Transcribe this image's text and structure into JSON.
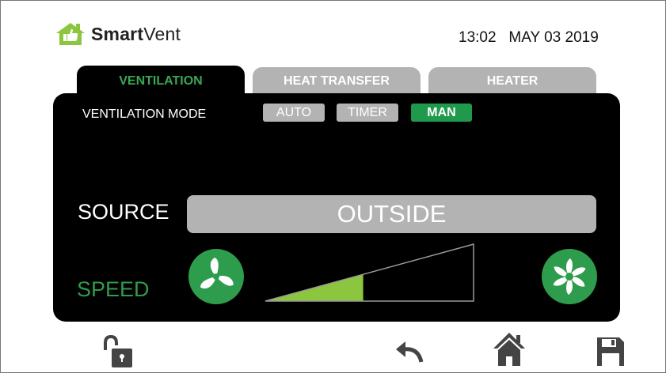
{
  "brand": {
    "name_bold": "Smart",
    "name_light": "Vent"
  },
  "datetime": {
    "time": "13:02",
    "date": "MAY 03 2019"
  },
  "tabs": [
    {
      "label": "VENTILATION",
      "active": true
    },
    {
      "label": "HEAT TRANSFER",
      "active": false
    },
    {
      "label": "HEATER",
      "active": false
    }
  ],
  "ventilation_mode": {
    "label": "VENTILATION MODE",
    "options": [
      {
        "label": "AUTO",
        "selected": false
      },
      {
        "label": "TIMER",
        "selected": false
      },
      {
        "label": "MAN",
        "selected": true
      }
    ]
  },
  "source": {
    "label": "SOURCE",
    "value": "OUTSIDE"
  },
  "speed": {
    "label": "SPEED",
    "level": 0.47
  },
  "icons": {
    "left_fan": "fan-decrease-icon",
    "right_fan": "fan-increase-icon",
    "lock": "unlocked-padlock-icon",
    "back": "undo-arrow-icon",
    "home": "home-icon",
    "save": "floppy-disk-icon"
  },
  "colors": {
    "accent_green": "#2e9c4d",
    "speed_fill": "#8cc63f",
    "inactive_gray": "#b3b3b3",
    "panel_black": "#000000",
    "icon_gray": "#444444"
  }
}
